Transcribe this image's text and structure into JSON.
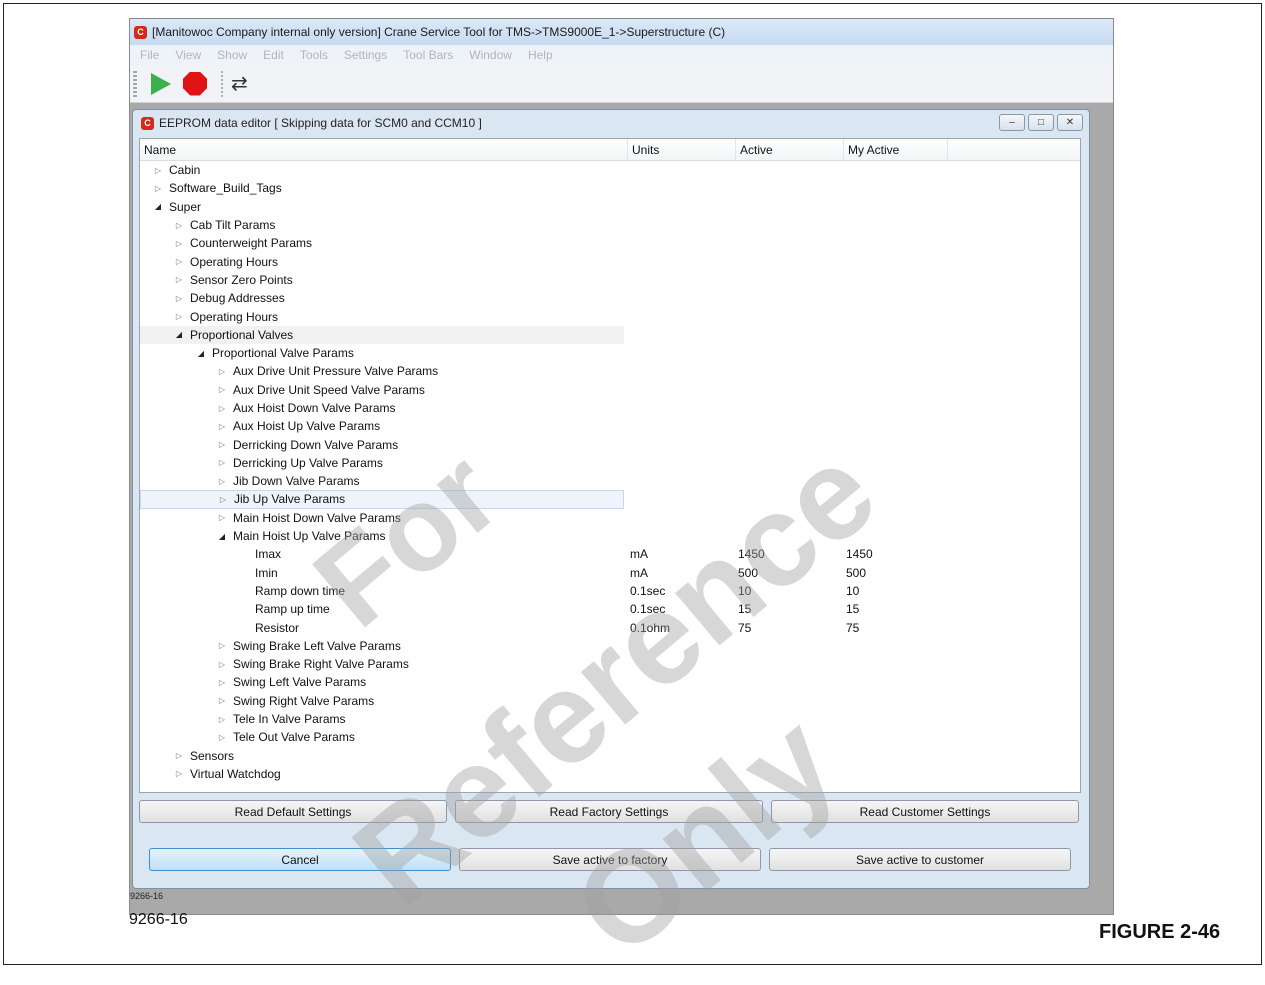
{
  "app": {
    "title": "[Manitowoc Company internal only  version] Crane Service Tool for TMS->TMS9000E_1->Superstructure (C)",
    "logo_letter": "C",
    "menu": [
      "File",
      "View",
      "Show",
      "Edit",
      "Tools",
      "Settings",
      "Tool Bars",
      "Window",
      "Help"
    ]
  },
  "editor": {
    "title": "EEPROM data editor [ Skipping data for SCM0 and CCM10 ]",
    "columns": {
      "name": "Name",
      "units": "Units",
      "active": "Active",
      "my_active": "My Active"
    },
    "rows": [
      {
        "label": "Cabin",
        "level": 0,
        "expander": "collapsed"
      },
      {
        "label": "Software_Build_Tags",
        "level": 0,
        "expander": "collapsed"
      },
      {
        "label": "Super",
        "level": 0,
        "expander": "expanded"
      },
      {
        "label": "Cab Tilt Params",
        "level": 1,
        "expander": "collapsed"
      },
      {
        "label": "Counterweight Params",
        "level": 1,
        "expander": "collapsed"
      },
      {
        "label": "Operating Hours",
        "level": 1,
        "expander": "collapsed"
      },
      {
        "label": "Sensor Zero Points",
        "level": 1,
        "expander": "collapsed"
      },
      {
        "label": "Debug Addresses",
        "level": 1,
        "expander": "collapsed"
      },
      {
        "label": "Operating Hours",
        "level": 1,
        "expander": "collapsed"
      },
      {
        "label": "Proportional Valves",
        "level": 1,
        "expander": "expanded",
        "highlight": "a"
      },
      {
        "label": "Proportional Valve Params",
        "level": 2,
        "expander": "expanded"
      },
      {
        "label": "Aux Drive Unit Pressure Valve Params",
        "level": 3,
        "expander": "collapsed"
      },
      {
        "label": "Aux Drive Unit Speed Valve Params",
        "level": 3,
        "expander": "collapsed"
      },
      {
        "label": "Aux Hoist Down Valve Params",
        "level": 3,
        "expander": "collapsed"
      },
      {
        "label": "Aux Hoist Up Valve Params",
        "level": 3,
        "expander": "collapsed"
      },
      {
        "label": "Derricking Down Valve Params",
        "level": 3,
        "expander": "collapsed"
      },
      {
        "label": "Derricking Up Valve Params",
        "level": 3,
        "expander": "collapsed"
      },
      {
        "label": "Jib Down Valve Params",
        "level": 3,
        "expander": "collapsed"
      },
      {
        "label": "Jib Up Valve Params",
        "level": 3,
        "expander": "collapsed",
        "highlight": "b"
      },
      {
        "label": "Main Hoist Down Valve Params",
        "level": 3,
        "expander": "collapsed"
      },
      {
        "label": "Main Hoist Up Valve Params",
        "level": 3,
        "expander": "expanded"
      },
      {
        "label": "Imax",
        "level": 4,
        "expander": "none",
        "units": "mA",
        "active": "1450",
        "my_active": "1450"
      },
      {
        "label": "Imin",
        "level": 4,
        "expander": "none",
        "units": "mA",
        "active": "500",
        "my_active": "500"
      },
      {
        "label": "Ramp down time",
        "level": 4,
        "expander": "none",
        "units": "0.1sec",
        "active": "10",
        "my_active": "10"
      },
      {
        "label": "Ramp up time",
        "level": 4,
        "expander": "none",
        "units": "0.1sec",
        "active": "15",
        "my_active": "15"
      },
      {
        "label": "Resistor",
        "level": 4,
        "expander": "none",
        "units": "0.1ohm",
        "active": "75",
        "my_active": "75"
      },
      {
        "label": "Swing Brake Left Valve Params",
        "level": 3,
        "expander": "collapsed"
      },
      {
        "label": "Swing Brake Right Valve Params",
        "level": 3,
        "expander": "collapsed"
      },
      {
        "label": "Swing Left Valve Params",
        "level": 3,
        "expander": "collapsed"
      },
      {
        "label": "Swing Right Valve Params",
        "level": 3,
        "expander": "collapsed"
      },
      {
        "label": "Tele In Valve Params",
        "level": 3,
        "expander": "collapsed"
      },
      {
        "label": "Tele Out Valve Params",
        "level": 3,
        "expander": "collapsed"
      },
      {
        "label": "Sensors",
        "level": 1,
        "expander": "collapsed"
      },
      {
        "label": "Virtual Watchdog",
        "level": 1,
        "expander": "collapsed"
      }
    ],
    "buttons": {
      "read_default": "Read Default Settings",
      "read_factory": "Read Factory Settings",
      "read_customer": "Read Customer Settings",
      "cancel": "Cancel",
      "save_factory": "Save active to factory",
      "save_customer": "Save active to customer"
    }
  },
  "figure": {
    "small_id": "9266-16",
    "id": "9266-16",
    "caption": "FIGURE 2-46"
  },
  "watermark": {
    "words": [
      "For",
      "Reference",
      "Only"
    ]
  },
  "icons": {
    "play": "play-icon",
    "stop": "stop-icon",
    "refresh": "refresh-icon"
  }
}
